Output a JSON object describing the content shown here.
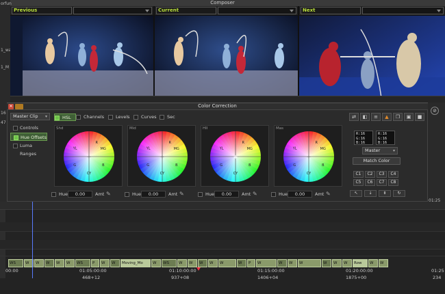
{
  "composer": {
    "title": "Composer",
    "left_labels": [
      "orfun",
      "1_wa",
      "1_M",
      "16",
      "47"
    ],
    "monitors": [
      {
        "label": "Previous"
      },
      {
        "label": "Current"
      },
      {
        "label": "Next"
      }
    ]
  },
  "color_correction": {
    "title": "Color Correction",
    "source_dropdown": "Master Clip",
    "tabs": [
      "HSL",
      "Channels",
      "Levels",
      "Curves",
      "Sec"
    ],
    "active_tab": "HSL",
    "side_buttons": [
      "Controls",
      "Hue Offsets",
      "Luma Ranges"
    ],
    "active_side": "Hue Offsets",
    "wheels": [
      {
        "label": "Shd",
        "hue": "0.00"
      },
      {
        "label": "Mid",
        "hue": "0.00"
      },
      {
        "label": "HII",
        "hue": "0.00"
      },
      {
        "label": "Mas",
        "hue": "0.00"
      }
    ],
    "wheel_marks": {
      "r": "R",
      "yl": "YL",
      "g": "G",
      "cy": "CY",
      "b": "B",
      "mg": "MG"
    },
    "hue_label": "Hue",
    "amt_label": "Amt",
    "rgb_readouts": [
      [
        "R:16",
        "G:16",
        "B:16"
      ],
      [
        "R:16",
        "G:16",
        "B:16"
      ]
    ],
    "master_dropdown": "Master",
    "match_color_label": "Match Color",
    "c_buttons": [
      "C1",
      "C2",
      "C3",
      "C4",
      "C5",
      "C6",
      "C7",
      "C8"
    ]
  },
  "timeline": {
    "clip_labels": [
      "WS",
      "W",
      "W",
      "W",
      "W",
      "W",
      "WS",
      "P",
      "W",
      "W",
      "Moving_Mo",
      "W",
      "WS",
      "W",
      "W",
      "W",
      "W",
      "W",
      "W",
      "P",
      "W",
      "W",
      "W",
      "W",
      "W",
      "W",
      "W",
      "Row",
      "W",
      "W"
    ],
    "timecodes": [
      "00:00",
      "01:05:00:00",
      "01:10:00:00",
      "01:15:00:00",
      "01:20:00:00",
      "01:25"
    ],
    "frames": [
      "468+12",
      "937+08",
      "1406+04",
      "1875+00",
      "234"
    ],
    "right_timecode": "01:25"
  }
}
